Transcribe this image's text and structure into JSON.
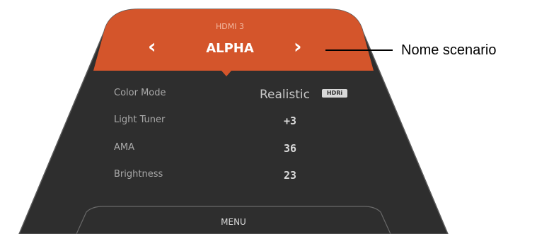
{
  "osd": {
    "input_source": "HDMI 3",
    "scenario_name": "ALPHA",
    "prev_arrow": "‹",
    "next_arrow": "›",
    "settings": [
      {
        "label": "Color Mode",
        "value": "Realistic"
      },
      {
        "label": "Light Tuner",
        "value": "+3"
      },
      {
        "label": "AMA",
        "value": "36"
      },
      {
        "label": "Brightness",
        "value": "23"
      }
    ],
    "hdr_badge": "HDRi",
    "menu_label": "MENU"
  },
  "callout": {
    "text": "Nome scenario"
  },
  "colors": {
    "header": "#d4552b",
    "panel": "#2e2e2e",
    "border": "#5a5a5a"
  }
}
